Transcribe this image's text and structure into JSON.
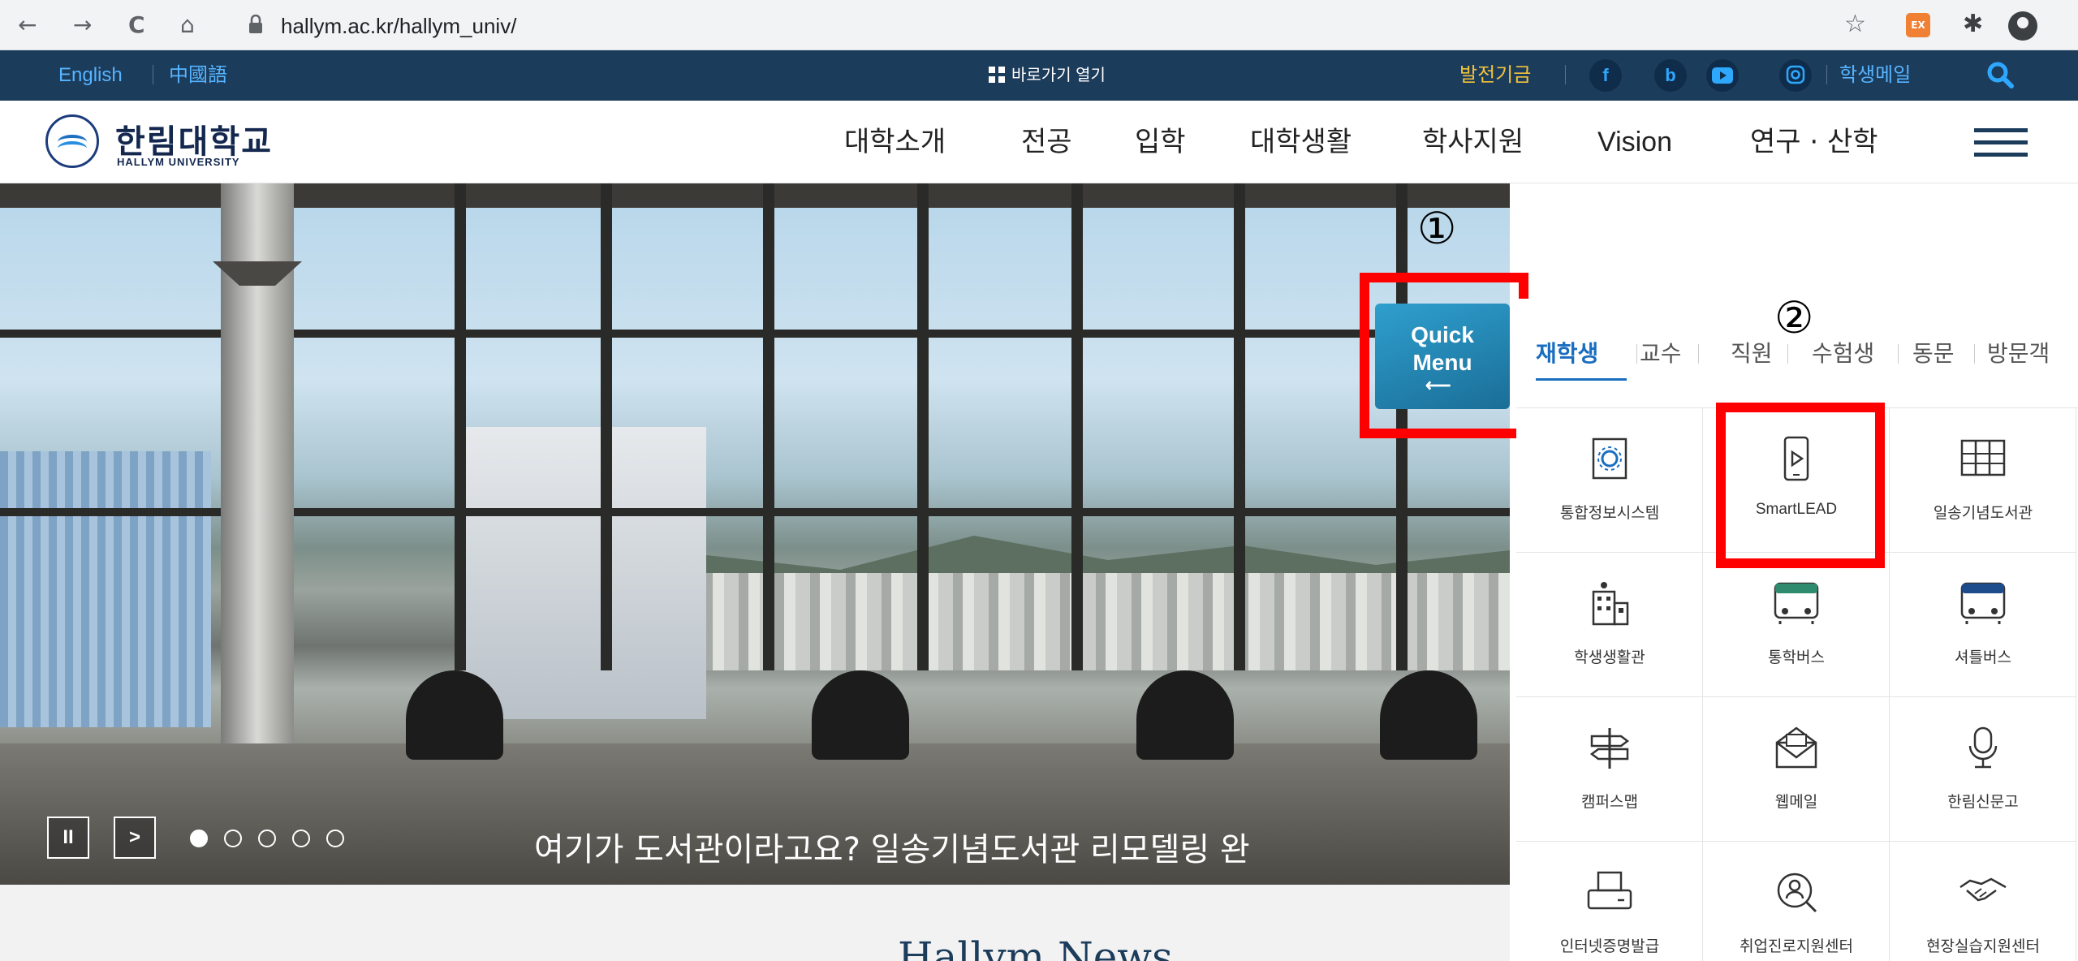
{
  "browser": {
    "url": "hallym.ac.kr/hallym_univ/",
    "ext_label": "EX"
  },
  "utility": {
    "english": "English",
    "chinese": "中國語",
    "quick_links": "바로가기 열기",
    "fund": "발전기금",
    "facebook": "f",
    "blog": "b",
    "student_mail": "학생메일"
  },
  "header": {
    "logo_ko": "한림대학교",
    "logo_en": "HALLYM UNIVERSITY",
    "nav": [
      "대학소개",
      "전공",
      "입학",
      "대학생활",
      "학사지원",
      "Vision",
      "연구 · 산학"
    ]
  },
  "hero": {
    "caption": "여기가 도서관이라고요?   일송기념도서관 리모델링 완",
    "pause_label": "II",
    "next_label": ">",
    "slide_count": 5,
    "active_slide": 1
  },
  "news": {
    "title": "Hallym News"
  },
  "quick_menu": {
    "button_line1": "Quick",
    "button_line2": "Menu",
    "annotation_1": "①",
    "annotation_2": "②",
    "tabs": [
      "재학생",
      "교수",
      "직원",
      "수험생",
      "동문",
      "방문객"
    ],
    "active_tab": "재학생",
    "items": [
      {
        "label": "통합정보시스템",
        "icon": "gear-document-icon"
      },
      {
        "label": "SmartLEAD",
        "icon": "tablet-play-icon"
      },
      {
        "label": "일송기념도서관",
        "icon": "bookshelf-icon"
      },
      {
        "label": "학생생활관",
        "icon": "dormitory-building-icon"
      },
      {
        "label": "통학버스",
        "icon": "bus-icon"
      },
      {
        "label": "셔틀버스",
        "icon": "bus-icon"
      },
      {
        "label": "캠퍼스맵",
        "icon": "signpost-icon"
      },
      {
        "label": "웹메일",
        "icon": "envelope-icon"
      },
      {
        "label": "한림신문고",
        "icon": "microphone-icon"
      },
      {
        "label": "인터넷증명발급",
        "icon": "printer-icon"
      },
      {
        "label": "취업진로지원센터",
        "icon": "search-person-icon"
      },
      {
        "label": "현장실습지원센터",
        "icon": "handshake-icon"
      }
    ]
  },
  "colors": {
    "utility_bg": "#1c3c5c",
    "accent_blue": "#1a6ec0",
    "fund_gold": "#f2c23c",
    "annotation_red": "#ff0000"
  }
}
